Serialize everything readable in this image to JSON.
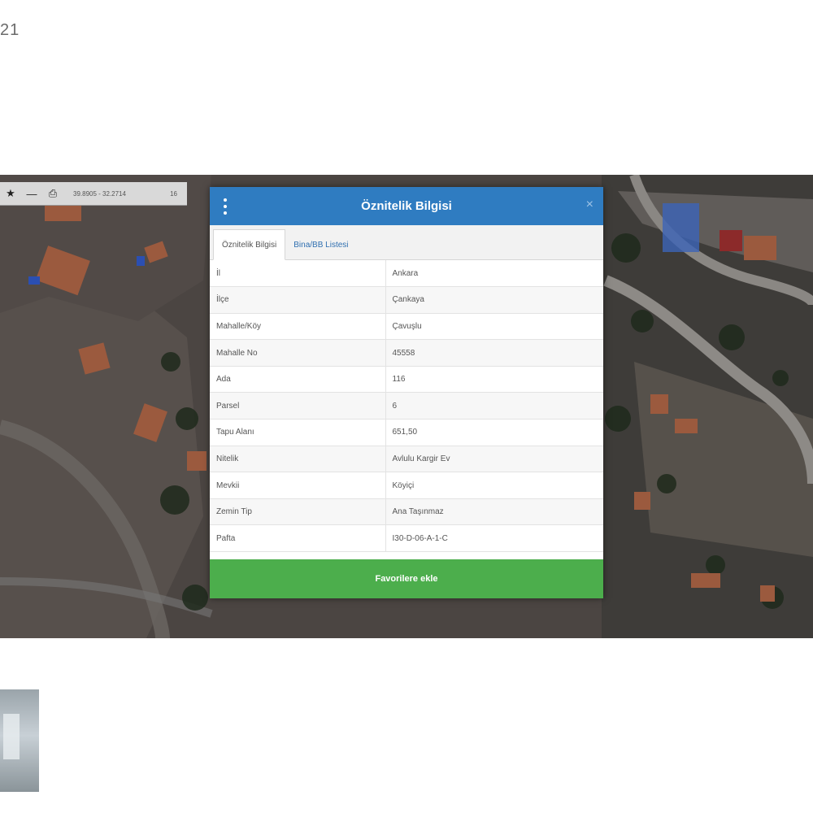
{
  "corner_text": "21",
  "map": {
    "toolbar": {
      "icons": [
        "star-icon",
        "minus-icon",
        "print-icon"
      ],
      "coordinates": "39.8905 - 32.2714",
      "zoom": "16"
    }
  },
  "dialog": {
    "title": "Öznitelik Bilgisi",
    "close_label": "×",
    "tabs": [
      {
        "label": "Öznitelik Bilgisi",
        "active": true
      },
      {
        "label": "Bina/BB Listesi",
        "active": false
      }
    ],
    "rows": [
      {
        "key": "İl",
        "value": "Ankara"
      },
      {
        "key": "İlçe",
        "value": "Çankaya"
      },
      {
        "key": "Mahalle/Köy",
        "value": "Çavuşlu"
      },
      {
        "key": "Mahalle No",
        "value": "45558"
      },
      {
        "key": "Ada",
        "value": "116"
      },
      {
        "key": "Parsel",
        "value": "6"
      },
      {
        "key": "Tapu Alanı",
        "value": "651,50"
      },
      {
        "key": "Nitelik",
        "value": "Avlulu Kargir Ev"
      },
      {
        "key": "Mevkii",
        "value": "Köyiçi"
      },
      {
        "key": "Zemin Tip",
        "value": "Ana Taşınmaz"
      },
      {
        "key": "Pafta",
        "value": "I30-D-06-A-1-C"
      }
    ],
    "favorite_button": "Favorilere ekle"
  },
  "colors": {
    "header": "#2f7cc1",
    "button": "#4cae4c"
  }
}
